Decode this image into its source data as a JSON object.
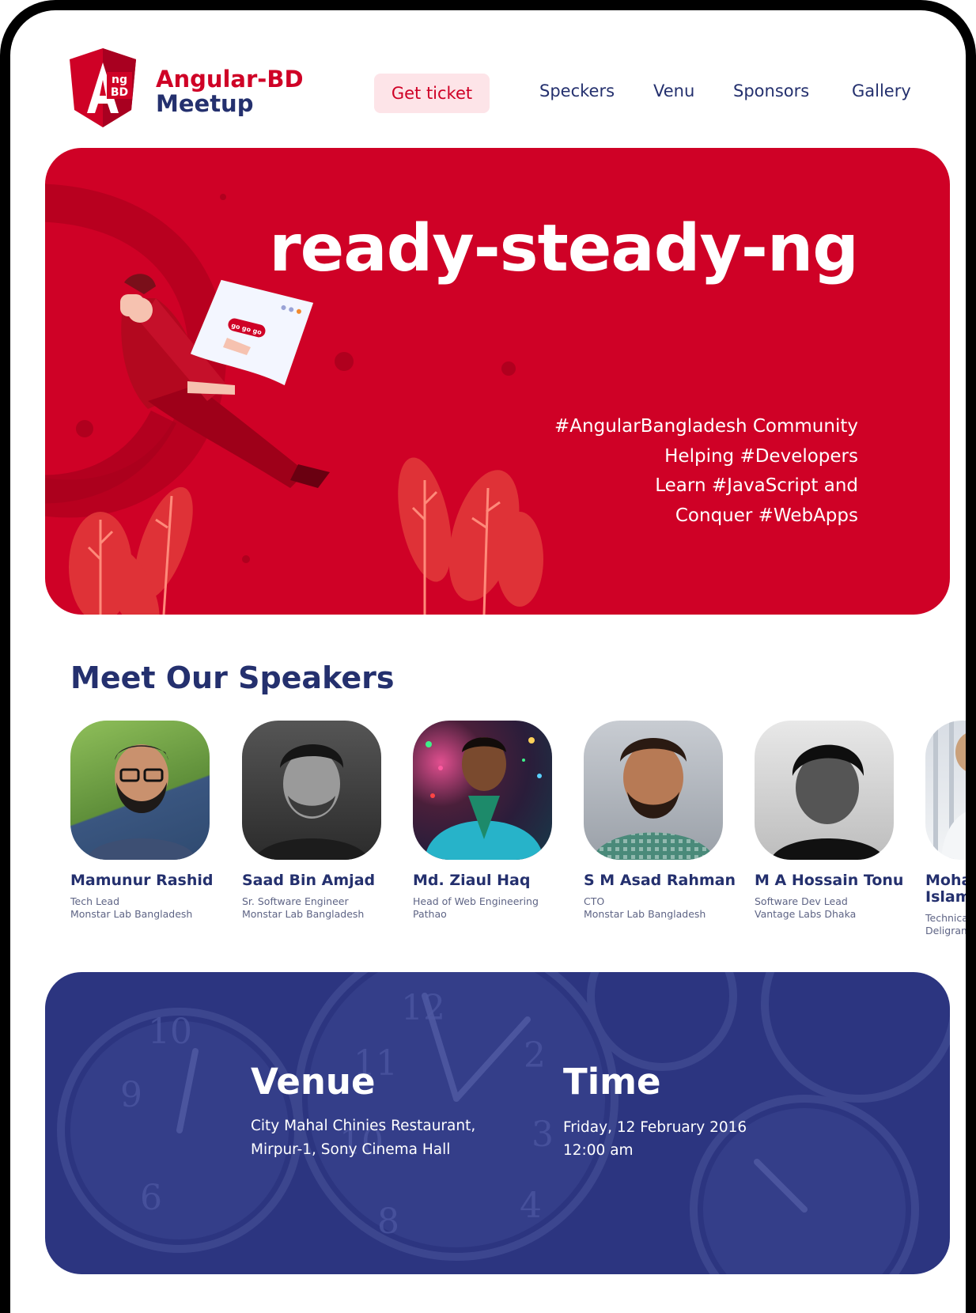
{
  "brand": {
    "logo_text_top": "ng",
    "logo_text_bottom": "BD",
    "logo_letter": "A",
    "line1": "Angular-BD",
    "line2": "Meetup",
    "color_red": "#cf0126",
    "color_navy": "#24306e"
  },
  "nav": {
    "ticket_label": "Get ticket",
    "links": [
      "Speckers",
      "Venu",
      "Sponsors",
      "Gallery"
    ]
  },
  "hero": {
    "title": "ready-steady-ng",
    "card_button_text": "go go go",
    "tagline": [
      "#AngularBangladesh Community",
      "Helping #Developers",
      "Learn #JavaScript and",
      "Conquer #WebApps"
    ],
    "bg_color": "#cf0126"
  },
  "speakers": {
    "title": "Meet Our Speakers",
    "items": [
      {
        "name": "Mamunur Rashid",
        "role": "Tech Lead",
        "org": "Monstar Lab Bangladesh"
      },
      {
        "name": "Saad Bin Amjad",
        "role": "Sr. Software Engineer",
        "org": "Monstar Lab Bangladesh"
      },
      {
        "name": "Md. Ziaul Haq",
        "role": "Head of Web Engineering",
        "org": "Pathao"
      },
      {
        "name": "S M Asad Rahman",
        "role": "CTO",
        "org": "Monstar Lab Bangladesh"
      },
      {
        "name": "M A Hossain Tonu",
        "role": "Software Dev Lead",
        "org": "Vantage Labs Dhaka"
      },
      {
        "name_line1": "Mohan",
        "name_line2": "Islam (",
        "role": "Technical E",
        "org": "Deligram"
      }
    ]
  },
  "event": {
    "venue_title": "Venue",
    "venue_lines": [
      "City Mahal Chinies Restaurant,",
      "Mirpur-1, Sony Cinema Hall"
    ],
    "time_title": "Time",
    "time_lines": [
      "Friday, 12 February 2016",
      "12:00 am"
    ],
    "bg_color": "#2c3580"
  }
}
